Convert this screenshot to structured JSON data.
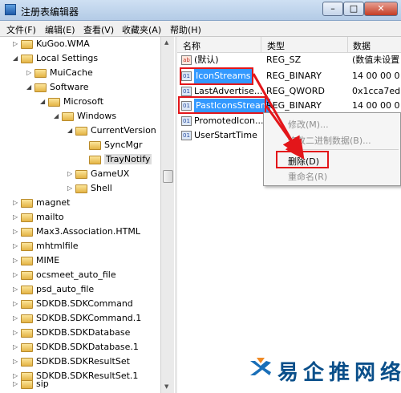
{
  "window": {
    "title": "注册表编辑器"
  },
  "menu": [
    "文件(F)",
    "编辑(E)",
    "查看(V)",
    "收藏夹(A)",
    "帮助(H)"
  ],
  "tree": [
    {
      "label": "KuGoo.WMA",
      "expander": "▷"
    },
    {
      "label": "Local Settings",
      "expander": "◢"
    },
    {
      "label": "MuiCache",
      "expander": "▷"
    },
    {
      "label": "Software",
      "expander": "◢"
    },
    {
      "label": "Microsoft",
      "expander": "◢"
    },
    {
      "label": "Windows",
      "expander": "◢"
    },
    {
      "label": "CurrentVersion",
      "expander": "◢"
    },
    {
      "label": "SyncMgr",
      "expander": ""
    },
    {
      "label": "TrayNotify",
      "expander": ""
    },
    {
      "label": "GameUX",
      "expander": "▷"
    },
    {
      "label": "Shell",
      "expander": "▷"
    },
    {
      "label": "magnet",
      "expander": "▷"
    },
    {
      "label": "mailto",
      "expander": "▷"
    },
    {
      "label": "Max3.Association.HTML",
      "expander": "▷"
    },
    {
      "label": "mhtmlfile",
      "expander": "▷"
    },
    {
      "label": "MIME",
      "expander": "▷"
    },
    {
      "label": "ocsmeet_auto_file",
      "expander": "▷"
    },
    {
      "label": "psd_auto_file",
      "expander": "▷"
    },
    {
      "label": "SDKDB.SDKCommand",
      "expander": "▷"
    },
    {
      "label": "SDKDB.SDKCommand.1",
      "expander": "▷"
    },
    {
      "label": "SDKDB.SDKDatabase",
      "expander": "▷"
    },
    {
      "label": "SDKDB.SDKDatabase.1",
      "expander": "▷"
    },
    {
      "label": "SDKDB.SDKResultSet",
      "expander": "▷"
    },
    {
      "label": "SDKDB.SDKResultSet.1",
      "expander": "▷"
    },
    {
      "label": "sip",
      "expander": "▷"
    }
  ],
  "columns": {
    "name": "名称",
    "type": "类型",
    "data": "数据"
  },
  "values": [
    {
      "name": "(默认)",
      "type": "REG_SZ",
      "data": "(数值未设置",
      "icon": "ab"
    },
    {
      "name": "IconStreams",
      "type": "REG_BINARY",
      "data": "14 00 00 0",
      "icon": "bin"
    },
    {
      "name": "LastAdvertise...",
      "type": "REG_QWORD",
      "data": "0x1cca7ed",
      "icon": "bin"
    },
    {
      "name": "PastIconsStream",
      "type": "REG_BINARY",
      "data": "14 00 00 0",
      "icon": "bin"
    },
    {
      "name": "PromotedIcon...",
      "type": "",
      "data": "",
      "icon": "bin"
    },
    {
      "name": "UserStartTime",
      "type": "",
      "data": "",
      "icon": "bin"
    }
  ],
  "context_menu": [
    "修改(M)...",
    "修改二进制数据(B)...",
    "删除(D)",
    "重命名(R)"
  ],
  "watermark": {
    "text": "易企推网络"
  },
  "colors": {
    "highlight": "#3399ff",
    "annotation_red": "#e3161a"
  }
}
